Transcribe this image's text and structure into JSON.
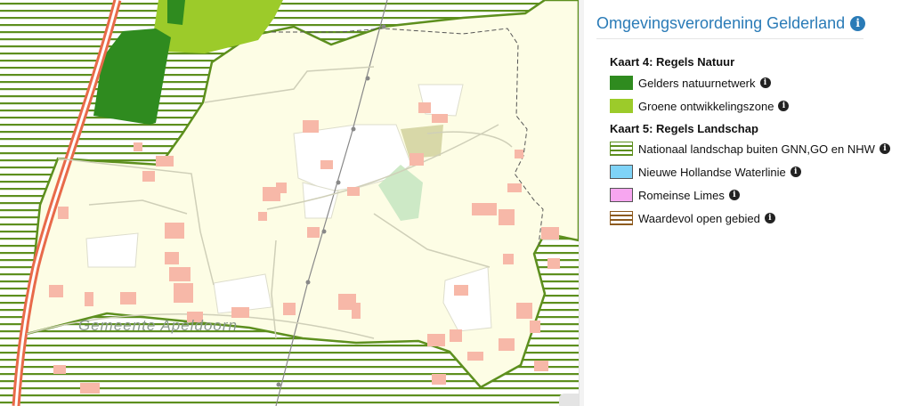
{
  "map": {
    "municipality_label": "Gemeente Apeldoorn"
  },
  "legend": {
    "title": "Omgevingsverordening Gelderland",
    "title_icon": "info-icon",
    "sections": [
      {
        "heading": "Kaart 4: Regels Natuur",
        "items": [
          {
            "label": "Gelders natuurnetwerk",
            "color": "#2f8b1f",
            "style": "solid"
          },
          {
            "label": "Groene ontwikkelingszone",
            "color": "#9ccb2a",
            "style": "solid"
          }
        ]
      },
      {
        "heading": "Kaart 5: Regels Landschap",
        "items": [
          {
            "label": "Nationaal landschap buiten GNN,GO en NHW",
            "color": "#5d8f1e",
            "style": "hatched"
          },
          {
            "label": "Nieuwe Hollandse Waterlinie",
            "color": "#7fd3f7",
            "style": "solid"
          },
          {
            "label": "Romeinse Limes",
            "color": "#f7a6f0",
            "style": "solid"
          },
          {
            "label": "Waardevol open gebied",
            "color": "#8c5a1e",
            "style": "hatched"
          }
        ]
      }
    ]
  }
}
